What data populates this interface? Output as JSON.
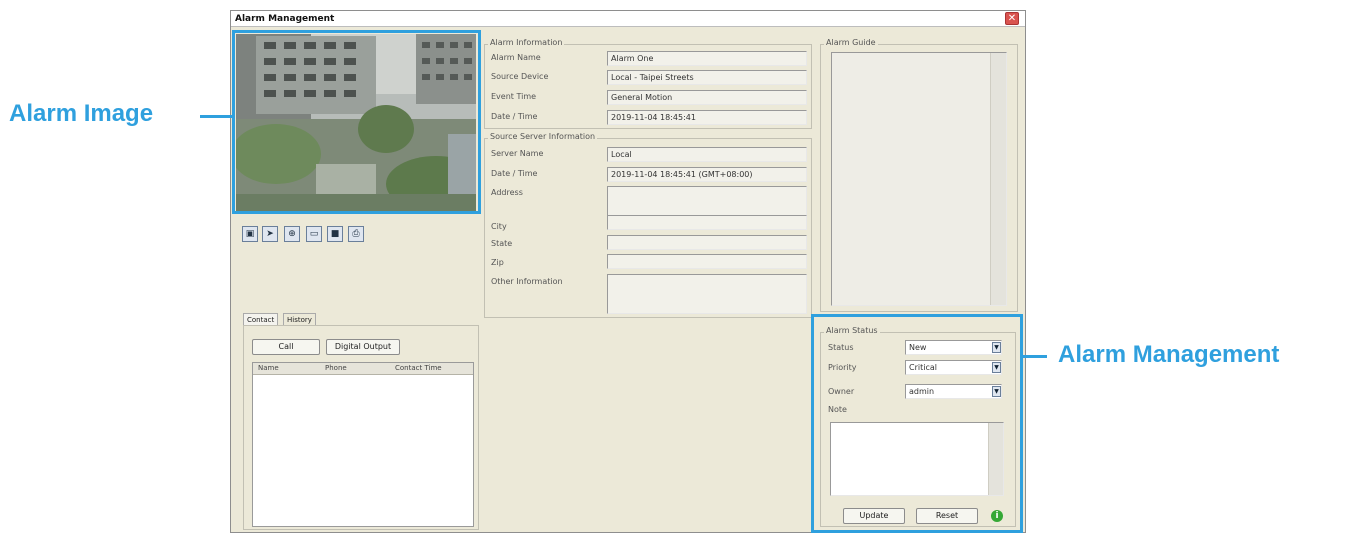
{
  "window": {
    "title": "Alarm Management"
  },
  "callouts": {
    "alarm_image": "Alarm Image",
    "alarm_management": "Alarm Management"
  },
  "toolbar": {
    "icons": [
      "snapshot-icon",
      "pointer-icon",
      "zoom-icon",
      "fit-icon",
      "save-icon",
      "print-icon"
    ]
  },
  "alarm_info": {
    "group_label": "Alarm Information",
    "fields": [
      {
        "label": "Alarm Name",
        "value": "Alarm One"
      },
      {
        "label": "Source Device",
        "value": "Local - Taipei Streets"
      },
      {
        "label": "Event Time",
        "value": "General Motion"
      },
      {
        "label": "Date / Time",
        "value": "2019-11-04 18:45:41"
      }
    ]
  },
  "server_info": {
    "group_label": "Source Server Information",
    "fields": [
      {
        "label": "Server Name",
        "value": "Local"
      },
      {
        "label": "Date / Time",
        "value": "2019-11-04 18:45:41 (GMT+08:00)"
      },
      {
        "label": "Address",
        "value": ""
      },
      {
        "label": "City",
        "value": ""
      },
      {
        "label": "State",
        "value": ""
      },
      {
        "label": "Zip",
        "value": ""
      },
      {
        "label": "Other Information",
        "value": ""
      }
    ]
  },
  "alarm_guide": {
    "group_label": "Alarm Guide"
  },
  "contact": {
    "tabs": [
      "Contact",
      "History"
    ],
    "call_label": "Call",
    "digital_output_label": "Digital Output",
    "columns": [
      "Name",
      "Phone",
      "Contact Time"
    ]
  },
  "alarm_status": {
    "group_label": "Alarm Status",
    "status_label": "Status",
    "status_value": "New",
    "priority_label": "Priority",
    "priority_value": "Critical",
    "owner_label": "Owner",
    "owner_value": "admin",
    "note_label": "Note",
    "update_label": "Update",
    "reset_label": "Reset"
  }
}
